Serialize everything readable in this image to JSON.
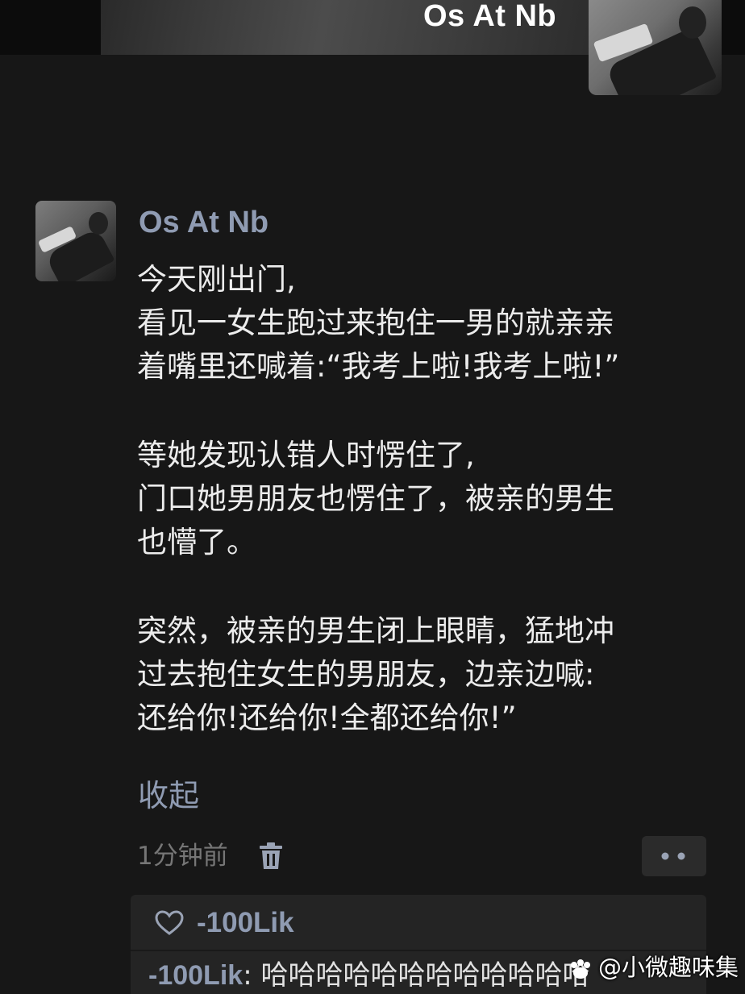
{
  "header": {
    "display_name": "Os At Nb"
  },
  "post": {
    "author": "Os At Nb",
    "paragraphs": [
      [
        "今天刚出门,",
        "看见一女生跑过来抱住一男的就亲亲",
        "着嘴里还喊着:“我考上啦!我考上啦!”"
      ],
      [
        "等她发现认错人时愣住了,",
        "门口她男朋友也愣住了，被亲的男生",
        "也懵了。"
      ],
      [
        "突然，被亲的男生闭上眼睛，猛地冲",
        "过去抱住女生的男朋友，边亲边喊:",
        "还给你!还给你!全都还给你!”"
      ]
    ],
    "collapse_label": "收起",
    "timestamp": "1分钟前",
    "trash_icon": "trash-icon",
    "more_icon": "more-dots-icon"
  },
  "interactions": {
    "like_icon": "heart-outline-icon",
    "liked_by": "-100Lik",
    "comment": {
      "author": "-100Lik",
      "separator": ": ",
      "text": "哈哈哈哈哈哈哈哈哈哈哈哈"
    }
  },
  "watermark": {
    "icon": "paw-logo-icon",
    "text": "@小微趣味集"
  },
  "colors": {
    "background": "#171717",
    "name_accent": "#8f9bb2",
    "text": "#ececec",
    "muted": "#767676",
    "panel": "#242424"
  }
}
